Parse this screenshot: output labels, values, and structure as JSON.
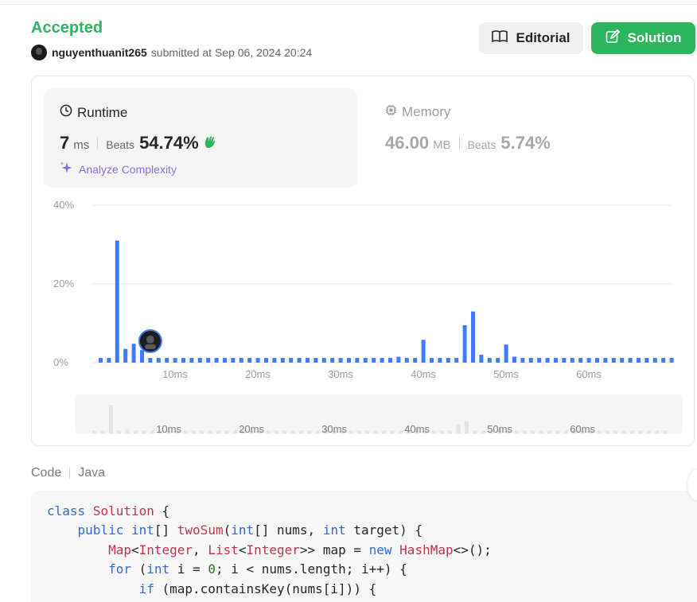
{
  "result": {
    "status": "Accepted",
    "username": "nguyenthuanit265",
    "submitted_text": "submitted at Sep 06, 2024 20:24"
  },
  "buttons": {
    "editorial": "Editorial",
    "solution": "Solution"
  },
  "runtime": {
    "title": "Runtime",
    "value": "7",
    "unit": "ms",
    "beats_label": "Beats",
    "beats": "54.74%",
    "analyze": "Analyze Complexity"
  },
  "memory": {
    "title": "Memory",
    "value": "46.00",
    "unit": "MB",
    "beats_label": "Beats",
    "beats": "5.74%"
  },
  "chart_data": {
    "type": "bar",
    "y_ticks": [
      "40%",
      "20%",
      "0%"
    ],
    "ylim": [
      0,
      40
    ],
    "x_ticks": [
      "10ms",
      "20ms",
      "30ms",
      "40ms",
      "50ms",
      "60ms"
    ],
    "x_tick_values": [
      10,
      20,
      30,
      40,
      50,
      60
    ],
    "x": [
      1,
      2,
      3,
      4,
      5,
      6,
      7,
      8,
      9,
      10,
      11,
      12,
      13,
      14,
      15,
      16,
      17,
      18,
      19,
      20,
      21,
      22,
      23,
      24,
      25,
      26,
      27,
      28,
      29,
      30,
      31,
      32,
      33,
      34,
      35,
      36,
      37,
      38,
      39,
      40,
      41,
      42,
      43,
      44,
      45,
      46,
      47,
      48,
      49,
      50,
      51,
      52,
      53,
      54,
      55,
      56,
      57,
      58,
      59,
      60,
      61,
      62,
      63,
      64,
      65,
      66,
      67,
      68,
      69,
      70
    ],
    "values": [
      1.2,
      1.2,
      31,
      3.5,
      4.8,
      3.2,
      1.2,
      1.2,
      1.2,
      1.2,
      1.2,
      1.2,
      1.2,
      1.2,
      1.2,
      1.2,
      1.2,
      1.2,
      1.2,
      1.2,
      1.2,
      1.2,
      1.2,
      1.2,
      1.2,
      1.2,
      1.2,
      1.2,
      1.2,
      1.2,
      1.2,
      1.2,
      1.2,
      1.2,
      1.2,
      1.2,
      1.5,
      1.2,
      1.2,
      5.8,
      1.2,
      1.2,
      1.2,
      1.2,
      9.5,
      13,
      2,
      1.2,
      1.2,
      4.6,
      1.5,
      1.2,
      1.2,
      1.2,
      1.2,
      1.2,
      1.2,
      1.2,
      1.2,
      1.2,
      1.2,
      1.2,
      1.2,
      1.2,
      1.2,
      1.2,
      1.2,
      1.2,
      1.2,
      1.2
    ],
    "highlight_x": 7,
    "colors": {
      "bar": "#3f7bff",
      "overview_bar": "#e3e3e3",
      "grid": "#e8e8e8",
      "tick": "#9e9e9e",
      "overview_tick": "#7a7a7a"
    }
  },
  "code": {
    "label": "Code",
    "language": "Java"
  },
  "colors": {
    "accepted": "#2db55d",
    "solution_button": "#2db55d",
    "analyze": "#8a6ee0"
  },
  "icons": {
    "editorial": "book-icon",
    "solution": "edit-icon",
    "runtime": "clock-icon",
    "memory": "chip-icon",
    "beats": "clap-icon",
    "analyze": "sparkle-icon"
  }
}
